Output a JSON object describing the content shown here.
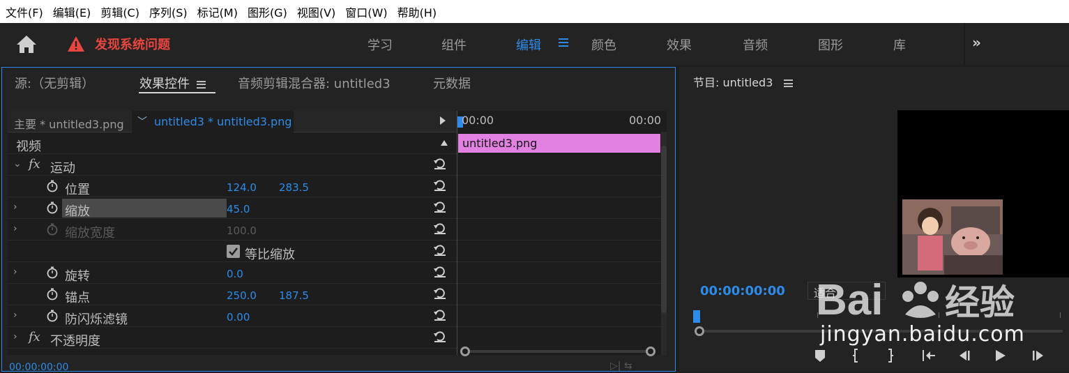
{
  "menubar": [
    "文件(F)",
    "编辑(E)",
    "剪辑(C)",
    "序列(S)",
    "标记(M)",
    "图形(G)",
    "视图(V)",
    "窗口(W)",
    "帮助(H)"
  ],
  "topbar": {
    "warning": "发现系统问题",
    "workspaces": [
      "学习",
      "组件",
      "编辑",
      "颜色",
      "效果",
      "音频",
      "图形",
      "库"
    ],
    "active_workspace": "编辑",
    "more": "»"
  },
  "left_panel": {
    "tabs": [
      "源:（无剪辑）",
      "效果控件",
      "音频剪辑混合器: untitled3",
      "元数据"
    ],
    "active_tab": "效果控件",
    "master_clip": "主要 * untitled3.png",
    "sequence_clip": "untitled3 * untitled3.png",
    "section_video": "视频",
    "rows": {
      "motion": "运动",
      "position": {
        "label": "位置",
        "x": "124.0",
        "y": "283.5"
      },
      "scale": {
        "label": "缩放",
        "value": "45.0"
      },
      "scale_width": {
        "label": "缩放宽度",
        "value": "100.0"
      },
      "uniform_scale": "等比缩放",
      "rotation": {
        "label": "旋转",
        "value": "0.0"
      },
      "anchor": {
        "label": "锚点",
        "x": "250.0",
        "y": "187.5"
      },
      "antiflicker": {
        "label": "防闪烁滤镜",
        "value": "0.00"
      },
      "opacity": "不透明度"
    },
    "timeline": {
      "start": "00:00",
      "end": "00:00",
      "clip": "untitled3.png"
    },
    "timecode": "00:00:00:00"
  },
  "right_panel": {
    "title": "节目: untitled3",
    "timecode": "00:00:00:00",
    "fit": "适合",
    "watermark": "Bai 经验",
    "watermark_url": "jingyan.baidu.com"
  },
  "colors": {
    "accent": "#2d8ceb",
    "clip": "#e281e2",
    "warning": "#e8463f"
  }
}
